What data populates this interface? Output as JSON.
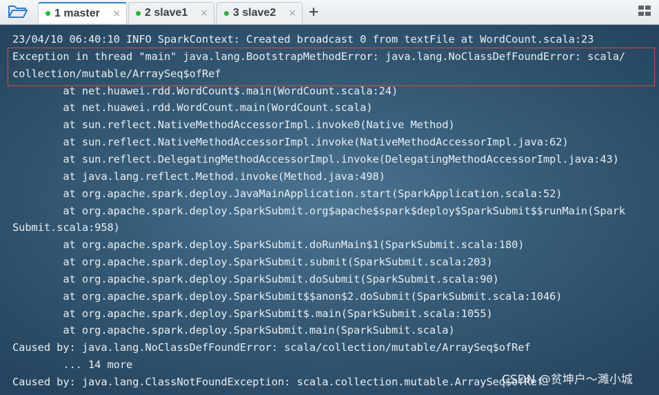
{
  "tabs": [
    {
      "label": "1 master",
      "status_color": "#1fb83a",
      "close": "×"
    },
    {
      "label": "2 slave1",
      "status_color": "#1fb83a",
      "close": "×"
    },
    {
      "label": "3 slave2",
      "status_color": "#1fb83a",
      "close": "×"
    }
  ],
  "add_tab_label": "+",
  "icons": {
    "open_folder": "folder-open-icon",
    "layout": "grid-layout-icon"
  },
  "terminal": {
    "lines": [
      "23/04/10 06:40:10 INFO SparkContext: Created broadcast 0 from textFile at WordCount.scala:23",
      "Exception in thread \"main\" java.lang.BootstrapMethodError: java.lang.NoClassDefFoundError: scala/",
      "collection/mutable/ArraySeq$ofRef",
      "        at net.huawei.rdd.WordCount$.main(WordCount.scala:24)",
      "        at net.huawei.rdd.WordCount.main(WordCount.scala)",
      "        at sun.reflect.NativeMethodAccessorImpl.invoke0(Native Method)",
      "        at sun.reflect.NativeMethodAccessorImpl.invoke(NativeMethodAccessorImpl.java:62)",
      "        at sun.reflect.DelegatingMethodAccessorImpl.invoke(DelegatingMethodAccessorImpl.java:43)",
      "        at java.lang.reflect.Method.invoke(Method.java:498)",
      "        at org.apache.spark.deploy.JavaMainApplication.start(SparkApplication.scala:52)",
      "        at org.apache.spark.deploy.SparkSubmit.org$apache$spark$deploy$SparkSubmit$$runMain(Spark",
      "Submit.scala:958)",
      "        at org.apache.spark.deploy.SparkSubmit.doRunMain$1(SparkSubmit.scala:180)",
      "        at org.apache.spark.deploy.SparkSubmit.submit(SparkSubmit.scala:203)",
      "        at org.apache.spark.deploy.SparkSubmit.doSubmit(SparkSubmit.scala:90)",
      "        at org.apache.spark.deploy.SparkSubmit$$anon$2.doSubmit(SparkSubmit.scala:1046)",
      "        at org.apache.spark.deploy.SparkSubmit$.main(SparkSubmit.scala:1055)",
      "        at org.apache.spark.deploy.SparkSubmit.main(SparkSubmit.scala)",
      "Caused by: java.lang.NoClassDefFoundError: scala/collection/mutable/ArraySeq$ofRef",
      "        ... 14 more",
      "Caused by: java.lang.ClassNotFoundException: scala.collection.mutable.ArraySeq$ofRef"
    ],
    "highlight_color": "#d0503a"
  },
  "watermark": "CSDN @贫坤户～濉小城"
}
